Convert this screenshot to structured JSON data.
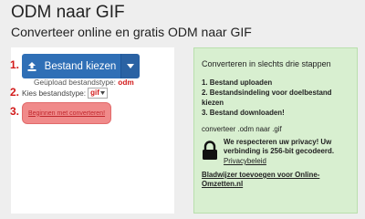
{
  "header": {
    "title": "ODM naar GIF",
    "subtitle": "Converteer online en gratis ODM naar GIF"
  },
  "converter": {
    "step1": "1.",
    "step2": "2.",
    "step3": "3.",
    "upload_button_label": "Bestand kiezen",
    "uploaded_type_label": "Geüpload bestandstype:",
    "uploaded_type_value": "odm",
    "target_type_label": "Kies bestandstype:",
    "target_type_value": "gif",
    "convert_button_label": "Beginnen met converteren!"
  },
  "info": {
    "title": "Converteren in slechts drie stappen",
    "steps": [
      "1. Bestand uploaden",
      "2. Bestandsindeling voor doelbestand kiezen",
      "3. Bestand downloaden!"
    ],
    "conversion_text": "converteer .odm naar .gif",
    "privacy_text": "We respecteren uw privacy! Uw verbinding is 256-bit gecodeerd.",
    "privacy_link": "Privacybeleid",
    "bookmark_link": "Bladwijzer toevoegen voor Online-Omzetten.nl"
  },
  "colors": {
    "primary_button": "#2f6fb6",
    "convert_button": "#f08a8a",
    "step_number": "#d21a1a",
    "info_panel": "#d8efd0"
  },
  "icons": {
    "upload": "upload-icon",
    "caret": "chevron-down-icon",
    "lock": "lock-icon"
  }
}
